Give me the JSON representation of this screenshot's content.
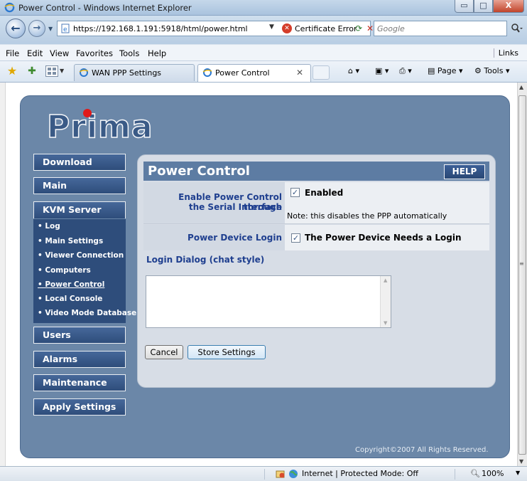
{
  "window": {
    "title": "Power Control - Windows Internet Explorer",
    "min_glyph": "▭",
    "max_glyph": "□",
    "close_glyph": "X"
  },
  "address": {
    "url": "https://192.168.1.191:5918/html/power.html",
    "certificate_label": "Certificate Error",
    "search_placeholder": "Google"
  },
  "menu": {
    "items": [
      "File",
      "Edit",
      "View",
      "Favorites",
      "Tools",
      "Help"
    ],
    "links_label": "Links"
  },
  "tabs": [
    {
      "label": "WAN PPP Settings"
    },
    {
      "label": "Power Control",
      "active": true
    }
  ],
  "commandbar": {
    "page_label": "Page",
    "tools_label": "Tools"
  },
  "app": {
    "logo": "Prima",
    "nav": [
      {
        "label": "Download"
      },
      {
        "label": "Main"
      },
      {
        "label": "KVM Server",
        "expanded": true
      },
      {
        "label": "Users"
      },
      {
        "label": "Alarms"
      },
      {
        "label": "Maintenance"
      },
      {
        "label": "Apply Settings"
      }
    ],
    "submenu": [
      {
        "label": "• Log"
      },
      {
        "label": "• Main Settings"
      },
      {
        "label": "• Viewer Connection"
      },
      {
        "label": "• Computers"
      },
      {
        "label": "• Power Control",
        "current": true
      },
      {
        "label": "• Local Console"
      },
      {
        "label": "• Video Mode Database"
      }
    ],
    "copyright": "Copyright©2007  All Rights Reserved."
  },
  "panel": {
    "title": "Power Control",
    "help_label": "HELP",
    "row1": {
      "label_line1": "Enable Power Control through",
      "label_line2": "the Serial Interface",
      "checkbox_label": "Enabled",
      "checked": true,
      "note": "Note: this disables the PPP automatically"
    },
    "row2": {
      "label": "Power Device Login",
      "checkbox_label": "The Power Device Needs a Login",
      "checked": true
    },
    "dialog_label": "Login Dialog (chat style)",
    "dialog_value": "",
    "cancel_label": "Cancel",
    "store_label": "Store Settings"
  },
  "statusbar": {
    "zone": "Internet | Protected Mode: Off",
    "zoom": "100%"
  },
  "colors": {
    "frame": "#6b87a8",
    "nav_button": "#2e4d7b",
    "panel_header": "#5d7ca3",
    "label_blue": "#1f3f8f",
    "logo_dot": "#e11a1a"
  }
}
